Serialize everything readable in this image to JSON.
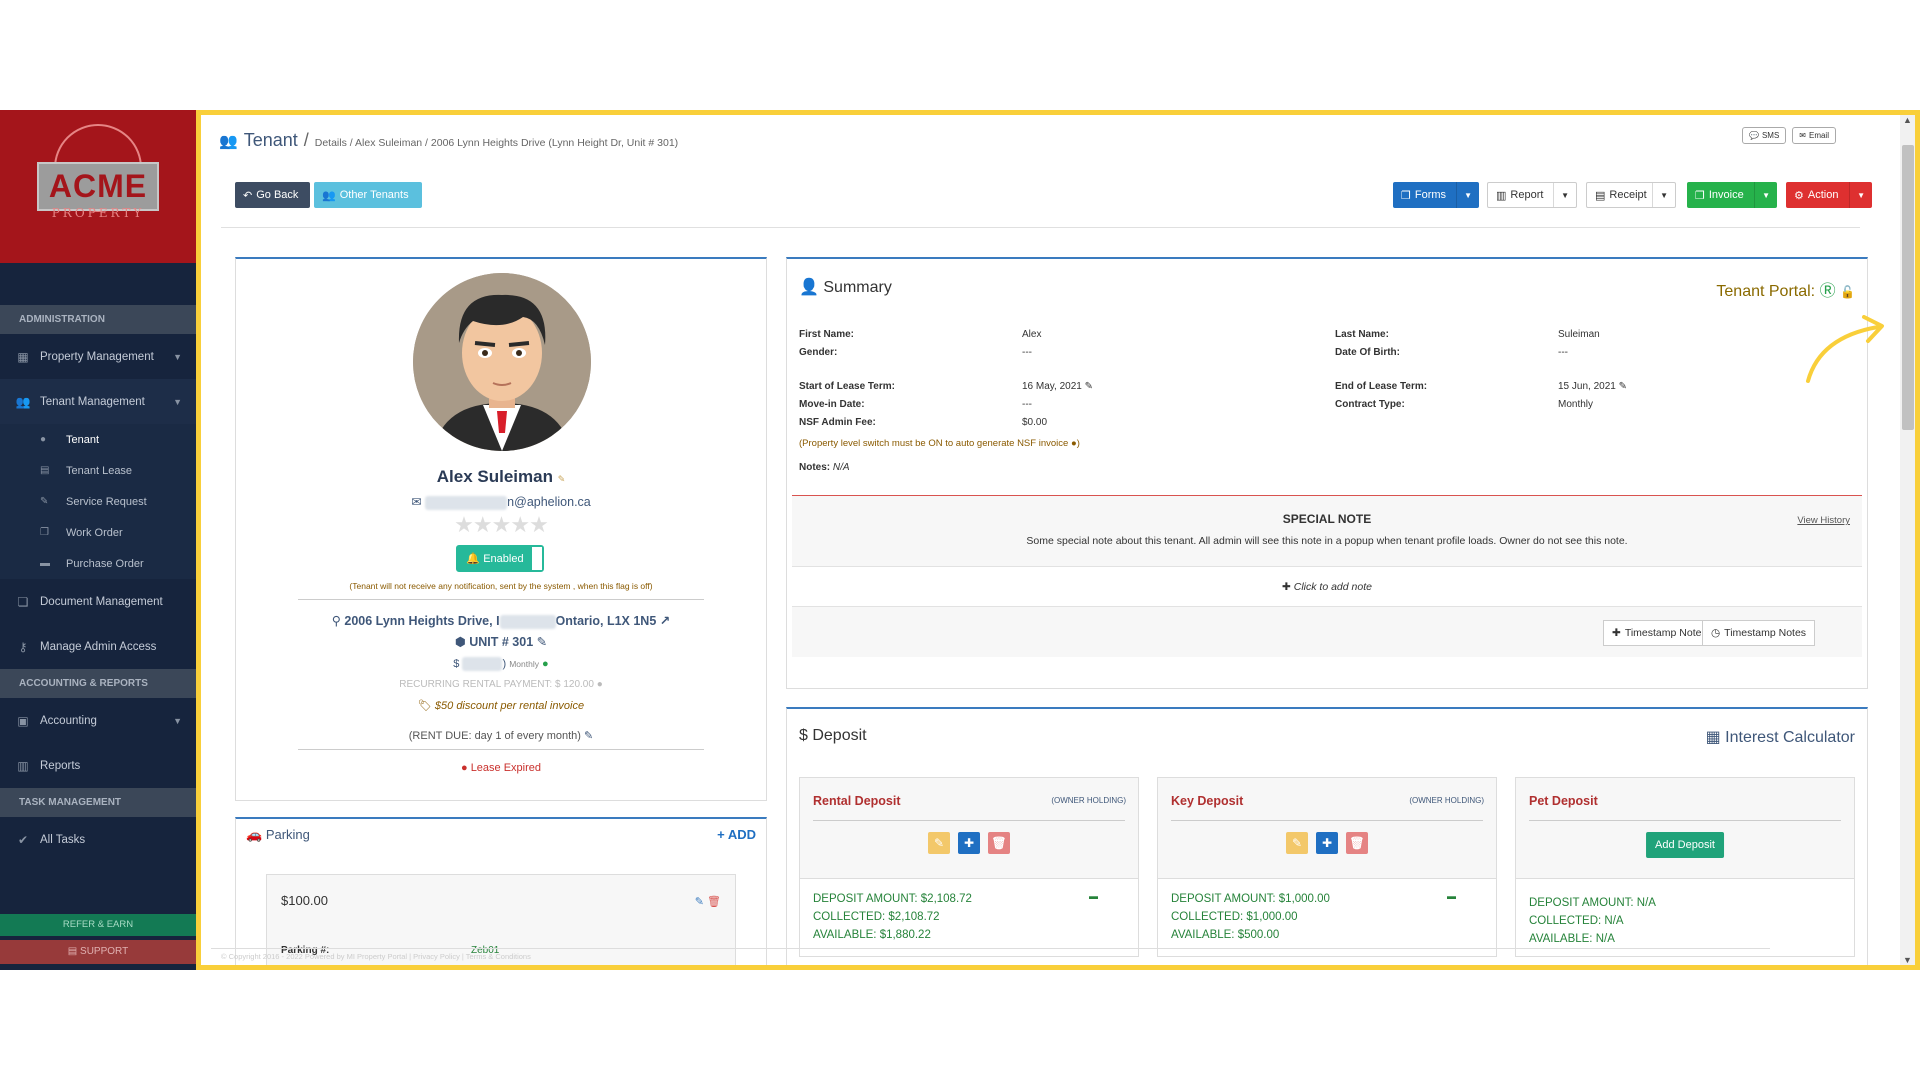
{
  "sidebar": {
    "logo_text": "ACME",
    "logo_sub": "PROPERTY",
    "sections": {
      "admin": "ADMINISTRATION",
      "accounting": "ACCOUNTING & REPORTS",
      "task": "TASK MANAGEMENT"
    },
    "items": {
      "property": "Property Management",
      "tenant": "Tenant Management",
      "document": "Document Management",
      "admin_access": "Manage Admin Access",
      "accounting": "Accounting",
      "reports": "Reports",
      "all_tasks": "All Tasks"
    },
    "tenant_sub": [
      "Tenant",
      "Tenant Lease",
      "Service Request",
      "Work Order",
      "Purchase Order"
    ],
    "refer": "REFER & EARN",
    "support": "SUPPORT"
  },
  "breadcrumb": {
    "title": "Tenant",
    "sep": "/",
    "rest": "Details / Alex Suleiman / 2006 Lynn Heights Drive (Lynn Height Dr, Unit # 301)"
  },
  "topright": {
    "sms": "SMS",
    "email": "Email"
  },
  "toolbar": {
    "go_back": "Go Back",
    "other_tenants": "Other Tenants",
    "forms": "Forms",
    "report": "Report",
    "receipt": "Receipt",
    "invoice": "Invoice",
    "action": "Action"
  },
  "profile": {
    "name": "Alex Suleiman",
    "email_suffix": "n@aphelion.ca",
    "enabled": "Enabled",
    "flag_note": "(Tenant will not receive any notification, sent by the system , when this flag is off)",
    "address_a": "2006 Lynn Heights Drive, I",
    "address_b": "Ontario, L1X 1N5",
    "unit": "UNIT # 301",
    "rent_prefix": "$",
    "rent_suffix": ")",
    "rent_period": "Monthly",
    "recurring": "RECURRING RENTAL PAYMENT: $ 120.00",
    "discount": "$50 discount per rental invoice",
    "rent_due": "(RENT DUE: day 1 of every month)",
    "lease_status": "Lease Expired",
    "rating": 0
  },
  "parking": {
    "title": "Parking",
    "add": "+ ADD",
    "amount": "$100.00",
    "label": "Parking #:",
    "value": "Zeb01"
  },
  "summary": {
    "title": "Summary",
    "portal": "Tenant Portal:",
    "fields": {
      "first_name_l": "First Name:",
      "first_name_v": "Alex",
      "last_name_l": "Last Name:",
      "last_name_v": "Suleiman",
      "gender_l": "Gender:",
      "gender_v": "---",
      "dob_l": "Date Of Birth:",
      "dob_v": "---",
      "start_l": "Start of Lease Term:",
      "start_v": "16 May, 2021",
      "end_l": "End of Lease Term:",
      "end_v": "15 Jun, 2021",
      "movein_l": "Move-in Date:",
      "movein_v": "---",
      "contract_l": "Contract Type:",
      "contract_v": "Monthly",
      "nsf_l": "NSF Admin Fee:",
      "nsf_v": "$0.00"
    },
    "nsf_note": "(Property level switch must be ON to auto generate NSF invoice",
    "notes_l": "Notes:",
    "notes_v": "N/A",
    "special_title": "SPECIAL NOTE",
    "view_history": "View History",
    "special_text": "Some special note about this tenant. All admin will see this note in a popup when tenant profile loads. Owner do not see this note.",
    "click_add": "Click to add note",
    "ts_note": "Timestamp Note",
    "ts_notes": "Timestamp Notes"
  },
  "deposit": {
    "title": "Deposit",
    "calculator": "Interest Calculator",
    "cards": [
      {
        "title": "Rental Deposit",
        "holding": "(OWNER HOLDING)",
        "amount": "DEPOSIT AMOUNT: $2,108.72",
        "collected": "COLLECTED: $2,108.72",
        "available": "AVAILABLE: $1,880.22"
      },
      {
        "title": "Key Deposit",
        "holding": "(OWNER HOLDING)",
        "amount": "DEPOSIT AMOUNT: $1,000.00",
        "collected": "COLLECTED: $1,000.00",
        "available": "AVAILABLE: $500.00"
      },
      {
        "title": "Pet Deposit",
        "add": "Add Deposit",
        "amount": "DEPOSIT AMOUNT: N/A",
        "collected": "COLLECTED: N/A",
        "available": "AVAILABLE: N/A"
      }
    ]
  },
  "footer": "© Copyright 2016 - 2022 Powered by MI Property Portal | Privacy Policy | Terms & Conditions",
  "colors": {
    "frame": "#f9cf3a",
    "sidebar": "#16243d",
    "logo_bg": "#a4151b",
    "primary": "#1f6fc2",
    "success": "#26b24b",
    "danger": "#de3030"
  }
}
